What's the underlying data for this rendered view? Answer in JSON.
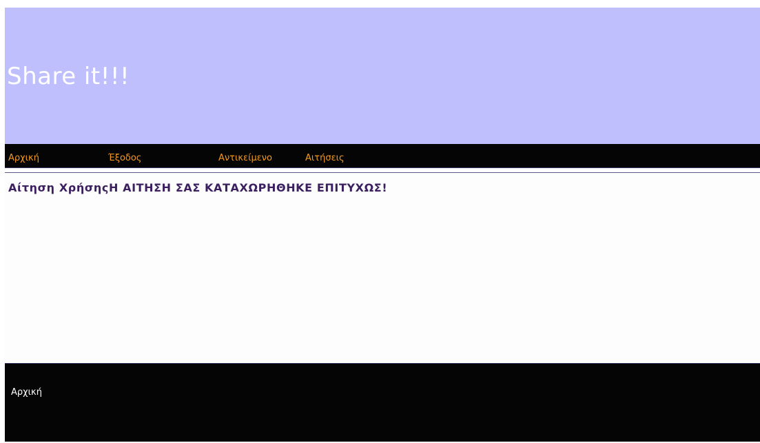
{
  "header": {
    "title": "Share it!!!"
  },
  "nav": {
    "items": [
      {
        "label": "Αρχική"
      },
      {
        "label": "Έξοδος"
      },
      {
        "label": "Αντικείμενο"
      },
      {
        "label": "Αιτήσεις"
      }
    ]
  },
  "content": {
    "heading": "Αίτηση ΧρήσηςΗ ΑΙΤΗΣΗ ΣΑΣ ΚΑΤΑΧΩΡΗΘΗΚΕ ΕΠΙΤΥΧΩΣ!"
  },
  "footer": {
    "link_label": "Αρχική"
  },
  "colors": {
    "header_bg": "#bfbffe",
    "nav_bg": "#050505",
    "nav_link": "#f59a1e",
    "heading": "#3b1f5e",
    "footer_bg": "#050505"
  }
}
